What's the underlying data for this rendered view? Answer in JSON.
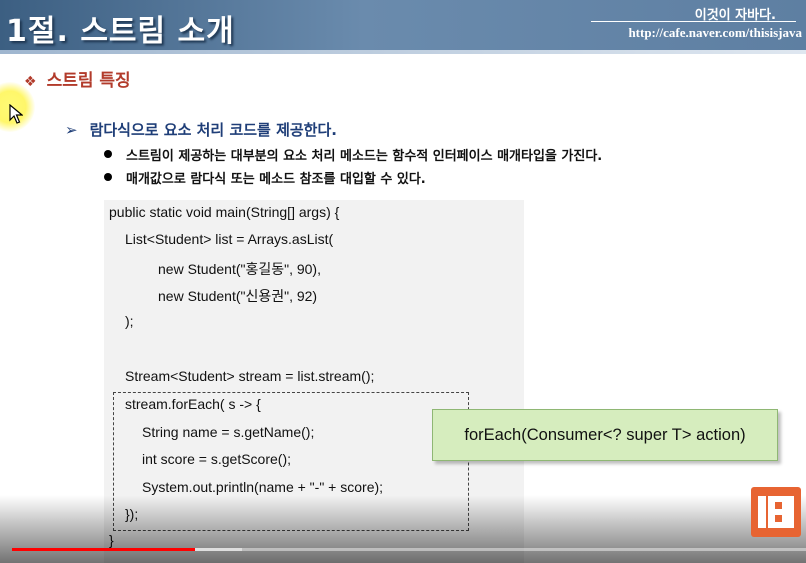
{
  "header": {
    "title": "1절. 스트림 소개",
    "brand": "이것이 자바다.",
    "url": "http://cafe.naver.com/thisisjava"
  },
  "section": {
    "bullet": "❖",
    "title": "스트림 특징"
  },
  "subhead": {
    "arrow": "➢",
    "text": "람다식으로 요소 처리 코드를 제공한다."
  },
  "points": [
    "스트림이 제공하는 대부분의 요소 처리 메소드는 함수적 인터페이스 매개타입을 가진다.",
    "매개값으로 람다식 또는 메소드 참조를 대입할 수 있다."
  ],
  "code": {
    "lines": [
      "public static void main(String[] args) {",
      "List<Student> list = Arrays.asList(",
      "new Student(\"홍길동\", 90),",
      "new Student(\"신용권\", 92)",
      ");",
      "Stream<Student> stream = list.stream();",
      "stream.forEach( s -> {",
      "String name = s.getName();",
      "int score = s.getScore();",
      "System.out.println(name + \"-\" + score);",
      "});",
      "}"
    ]
  },
  "callout": {
    "text": "forEach(Consumer<? super T> action)"
  },
  "player": {
    "played_fraction": 0.23,
    "buffered_fraction": 0.29
  },
  "colors": {
    "header_bg": "#5577a0",
    "section_title": "#b23b2b",
    "subhead": "#1f3e78",
    "callout_bg": "#d6edbe",
    "progress": "#ff0000",
    "logo_bg": "#e76432"
  },
  "icons": {
    "cursor": "mouse-pointer-icon",
    "logo": "channel-logo-icon"
  }
}
